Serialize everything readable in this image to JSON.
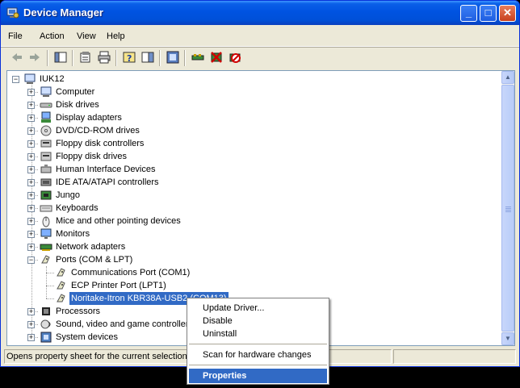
{
  "window": {
    "title": "Device Manager"
  },
  "menu": [
    "File",
    "Action",
    "View",
    "Help"
  ],
  "toolbar_icons": [
    "back-arrow-icon",
    "forward-arrow-icon",
    "show-hide-tree-icon",
    "properties-icon",
    "print-icon",
    "help-icon",
    "action-pane-icon",
    "scan-hardware-icon",
    "update-driver-icon",
    "uninstall-icon",
    "disable-icon"
  ],
  "tree": {
    "root": "IUK12",
    "categories": [
      {
        "label": "Computer",
        "icon": "computer-icon"
      },
      {
        "label": "Disk drives",
        "icon": "disk-drive-icon"
      },
      {
        "label": "Display adapters",
        "icon": "display-adapter-icon"
      },
      {
        "label": "DVD/CD-ROM drives",
        "icon": "dvd-drive-icon"
      },
      {
        "label": "Floppy disk controllers",
        "icon": "floppy-controller-icon"
      },
      {
        "label": "Floppy disk drives",
        "icon": "floppy-drive-icon"
      },
      {
        "label": "Human Interface Devices",
        "icon": "hid-icon"
      },
      {
        "label": "IDE ATA/ATAPI controllers",
        "icon": "ide-controller-icon"
      },
      {
        "label": "Jungo",
        "icon": "chip-icon"
      },
      {
        "label": "Keyboards",
        "icon": "keyboard-icon"
      },
      {
        "label": "Mice and other pointing devices",
        "icon": "mouse-icon"
      },
      {
        "label": "Monitors",
        "icon": "monitor-icon"
      },
      {
        "label": "Network adapters",
        "icon": "network-adapter-icon"
      },
      {
        "label": "Ports (COM & LPT)",
        "icon": "port-icon",
        "expanded": true,
        "children": [
          {
            "label": "Communications Port (COM1)",
            "icon": "port-icon"
          },
          {
            "label": "ECP Printer Port (LPT1)",
            "icon": "port-icon"
          },
          {
            "label": "Noritake-Itron KBR38A-USB2 (COM13)",
            "icon": "port-icon",
            "selected": true
          }
        ]
      },
      {
        "label": "Processors",
        "icon": "processor-icon"
      },
      {
        "label": "Sound, video and game controllers",
        "icon": "sound-icon"
      },
      {
        "label": "System devices",
        "icon": "system-devices-icon"
      }
    ]
  },
  "status": {
    "text": "Opens property sheet for the current selection."
  },
  "context_menu": {
    "items": [
      "Update Driver...",
      "Disable",
      "Uninstall",
      "Scan for hardware changes",
      "Properties"
    ],
    "highlighted": "Properties"
  },
  "colors": {
    "titlebar": "#0053e1",
    "selection": "#316ac5",
    "window_bg": "#ece9d8"
  }
}
